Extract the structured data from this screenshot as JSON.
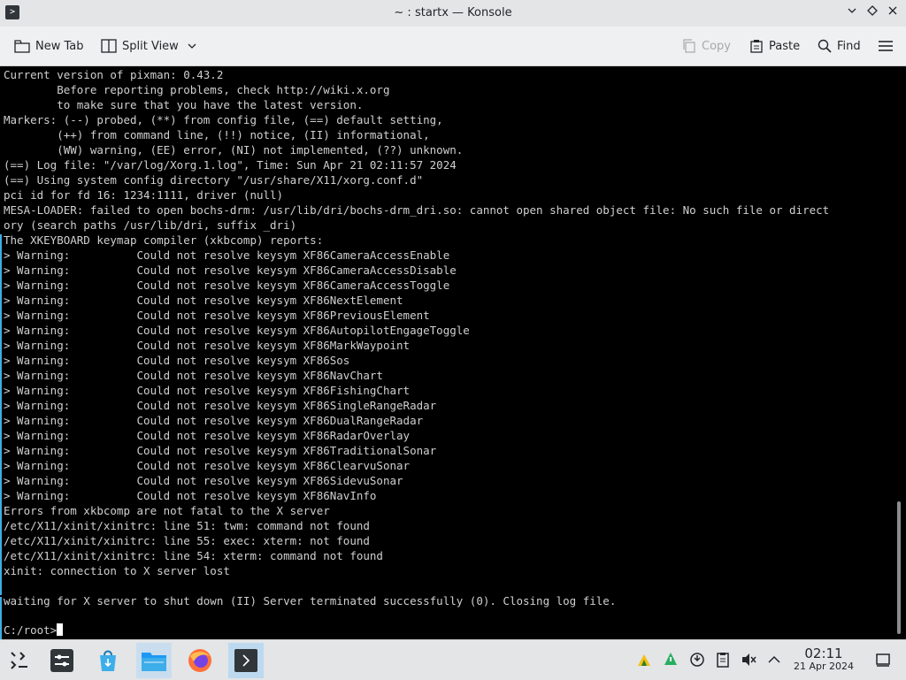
{
  "window": {
    "title": "~ : startx — Konsole"
  },
  "toolbar": {
    "new_tab": "New Tab",
    "split_view": "Split View",
    "copy": "Copy",
    "paste": "Paste",
    "find": "Find"
  },
  "terminal": {
    "lines": [
      "Current version of pixman: 0.43.2",
      "        Before reporting problems, check http://wiki.x.org",
      "        to make sure that you have the latest version.",
      "Markers: (--) probed, (**) from config file, (==) default setting,",
      "        (++) from command line, (!!) notice, (II) informational,",
      "        (WW) warning, (EE) error, (NI) not implemented, (??) unknown.",
      "(==) Log file: \"/var/log/Xorg.1.log\", Time: Sun Apr 21 02:11:57 2024",
      "(==) Using system config directory \"/usr/share/X11/xorg.conf.d\"",
      "pci id for fd 16: 1234:1111, driver (null)",
      "MESA-LOADER: failed to open bochs-drm: /usr/lib/dri/bochs-drm_dri.so: cannot open shared object file: No such file or direct",
      "ory (search paths /usr/lib/dri, suffix _dri)",
      "The XKEYBOARD keymap compiler (xkbcomp) reports:",
      "> Warning:          Could not resolve keysym XF86CameraAccessEnable",
      "> Warning:          Could not resolve keysym XF86CameraAccessDisable",
      "> Warning:          Could not resolve keysym XF86CameraAccessToggle",
      "> Warning:          Could not resolve keysym XF86NextElement",
      "> Warning:          Could not resolve keysym XF86PreviousElement",
      "> Warning:          Could not resolve keysym XF86AutopilotEngageToggle",
      "> Warning:          Could not resolve keysym XF86MarkWaypoint",
      "> Warning:          Could not resolve keysym XF86Sos",
      "> Warning:          Could not resolve keysym XF86NavChart",
      "> Warning:          Could not resolve keysym XF86FishingChart",
      "> Warning:          Could not resolve keysym XF86SingleRangeRadar",
      "> Warning:          Could not resolve keysym XF86DualRangeRadar",
      "> Warning:          Could not resolve keysym XF86RadarOverlay",
      "> Warning:          Could not resolve keysym XF86TraditionalSonar",
      "> Warning:          Could not resolve keysym XF86ClearvuSonar",
      "> Warning:          Could not resolve keysym XF86SidevuSonar",
      "> Warning:          Could not resolve keysym XF86NavInfo",
      "Errors from xkbcomp are not fatal to the X server",
      "/etc/X11/xinit/xinitrc: line 51: twm: command not found",
      "/etc/X11/xinit/xinitrc: line 55: exec: xterm: not found",
      "/etc/X11/xinit/xinitrc: line 54: xterm: command not found",
      "xinit: connection to X server lost",
      "",
      "waiting for X server to shut down (II) Server terminated successfully (0). Closing log file."
    ],
    "prompt": "C:/root>"
  },
  "taskbar": {
    "clock_time": "02:11",
    "clock_date": "21 Apr 2024"
  },
  "icons": {
    "app": "konsole-icon",
    "launcher": "application-launcher-icon",
    "settings": "system-settings-icon",
    "discover": "discover-store-icon",
    "files": "file-manager-icon",
    "browser": "firefox-icon",
    "terminal": "konsole-task-icon",
    "tray": [
      "network-icon",
      "update-icon",
      "clipboard-icon",
      "volume-muted-icon",
      "expand-tray-icon",
      "show-desktop-icon"
    ]
  },
  "colors": {
    "accent": "#3daee9",
    "terminal_bg": "#000000",
    "terminal_fg": "#d0d0d0"
  }
}
